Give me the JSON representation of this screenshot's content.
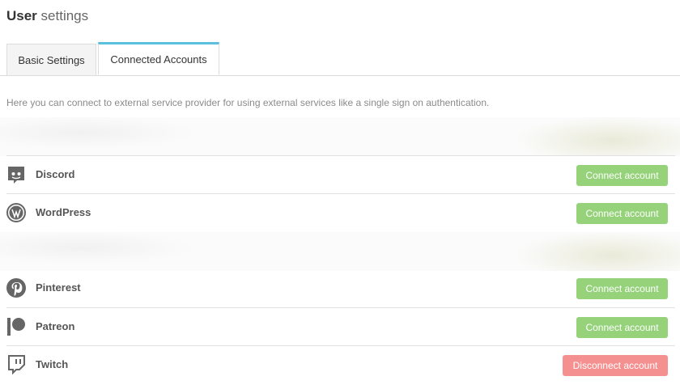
{
  "header": {
    "title_bold": "User",
    "title_light": "settings"
  },
  "tabs": [
    {
      "label": "Basic Settings"
    },
    {
      "label": "Connected Accounts"
    }
  ],
  "intro": "Here you can connect to external service provider for using external services like a single sign on authentication.",
  "accounts": [
    {
      "name": "Discord",
      "icon": "discord-icon",
      "action": "Connect account"
    },
    {
      "name": "WordPress",
      "icon": "wordpress-icon",
      "action": "Connect account"
    },
    {
      "name": "Pinterest",
      "icon": "pinterest-icon",
      "action": "Connect account"
    },
    {
      "name": "Patreon",
      "icon": "patreon-icon",
      "action": "Connect account"
    },
    {
      "name": "Twitch",
      "icon": "twitch-icon",
      "action": "Disconnect account"
    }
  ],
  "colors": {
    "accent_tab": "#5bc0de",
    "connect": "#95d27a",
    "disconnect": "#f59090"
  }
}
